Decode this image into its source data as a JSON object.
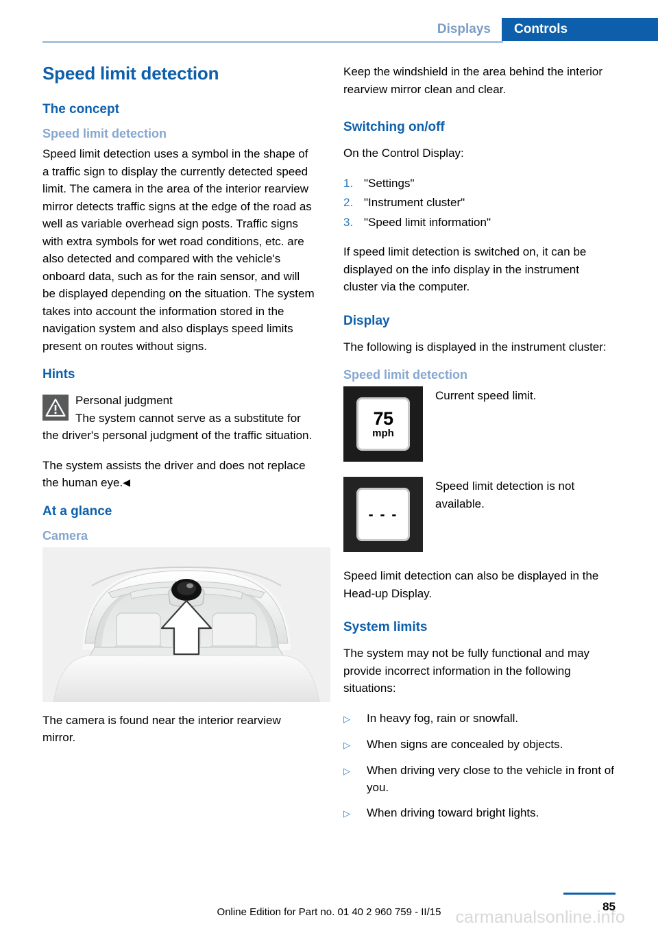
{
  "header": {
    "tab_inactive": "Displays",
    "tab_active": "Controls",
    "accent_blue": "#0d5fab",
    "muted_blue": "#86a6cf"
  },
  "left_column": {
    "title": "Speed limit detection",
    "concept_heading": "The concept",
    "concept_sub": "Speed limit detection",
    "concept_body": "Speed limit detection uses a symbol in the shape of a traffic sign to display the currently detected speed limit. The camera in the area of the interior rearview mirror detects traffic signs at the edge of the road as well as variable overhead sign posts. Traffic signs with extra symbols for wet road conditions, etc. are also detected and compared with the vehicle's onboard data, such as for the rain sensor, and will be displayed depending on the situation. The system takes into account the information stored in the navigation system and also displays speed limits present on routes without signs.",
    "hints_heading": "Hints",
    "hint_title": "Personal judgment",
    "hint_body": "The system cannot serve as a substitute for the driver's personal judgment of the traffic situation.",
    "hint_body2": "The system assists the driver and does not replace the human eye.",
    "hint_endmark": "◀",
    "warning_icon": "warning-triangle-icon",
    "ataglance_heading": "At a glance",
    "camera_sub": "Camera",
    "camera_figure_alt": "windshield-camera-illustration",
    "camera_caption": "The camera is found near the interior rearview mirror."
  },
  "right_column": {
    "intro_body": "Keep the windshield in the area behind the interior rearview mirror clean and clear.",
    "switching_heading": "Switching on/off",
    "switching_intro": "On the Control Display:",
    "steps": [
      {
        "num": "1.",
        "text": "\"Settings\""
      },
      {
        "num": "2.",
        "text": "\"Instrument cluster\""
      },
      {
        "num": "3.",
        "text": "\"Speed limit information\""
      }
    ],
    "switching_body": "If speed limit detection is switched on, it can be displayed on the info display in the instrument cluster via the computer.",
    "display_heading": "Display",
    "display_intro": "The following is displayed in the instrument cluster:",
    "display_sub": "Speed limit detection",
    "display_items": [
      {
        "icon": "speed-limit-sign-75-mph",
        "value": "75",
        "unit": "mph",
        "caption": "Current speed limit."
      },
      {
        "icon": "speed-limit-sign-unavailable",
        "value": "- - -",
        "unit": "",
        "caption": "Speed limit detection is not available."
      }
    ],
    "hud_body": "Speed limit detection can also be displayed in the Head-up Display.",
    "limits_heading": "System limits",
    "limits_intro": "The system may not be fully functional and may provide incorrect information in the following situations:",
    "limits_bullet": "▷",
    "limits": [
      "In heavy fog, rain or snowfall.",
      "When signs are concealed by objects.",
      "When driving very close to the vehicle in front of you.",
      "When driving toward bright lights."
    ]
  },
  "footer": {
    "edition_text": "Online Edition for Part no. 01 40 2 960 759 - II/15",
    "page_number": "85",
    "watermark": "carmanualsonline.info"
  }
}
